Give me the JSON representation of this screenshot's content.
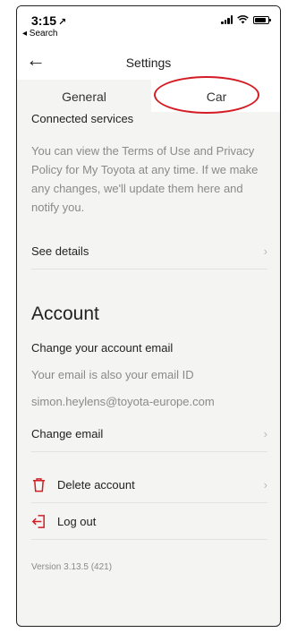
{
  "status": {
    "time": "3:15",
    "location_glyph": "↗",
    "back_label": "◂ Search"
  },
  "header": {
    "title": "Settings"
  },
  "tabs": [
    {
      "label": "General",
      "active": true
    },
    {
      "label": "Car",
      "active": false
    }
  ],
  "connected": {
    "title": "Connected services",
    "text": "You can view the Terms of Use and Privacy Policy for My Toyota at any time. If we make any changes, we'll update them here and notify you.",
    "details_label": "See details"
  },
  "account": {
    "title": "Account",
    "email_title": "Change your account email",
    "email_note": "Your email is also your email ID",
    "email_value": "simon.heylens@toyota-europe.com",
    "change_email_label": "Change email",
    "delete_label": "Delete account",
    "logout_label": "Log out"
  },
  "version": "Version 3.13.5 (421)",
  "icons": {
    "chevron": "›",
    "back": "←"
  },
  "colors": {
    "accent": "#d41c24",
    "background": "#f4f5f2"
  }
}
